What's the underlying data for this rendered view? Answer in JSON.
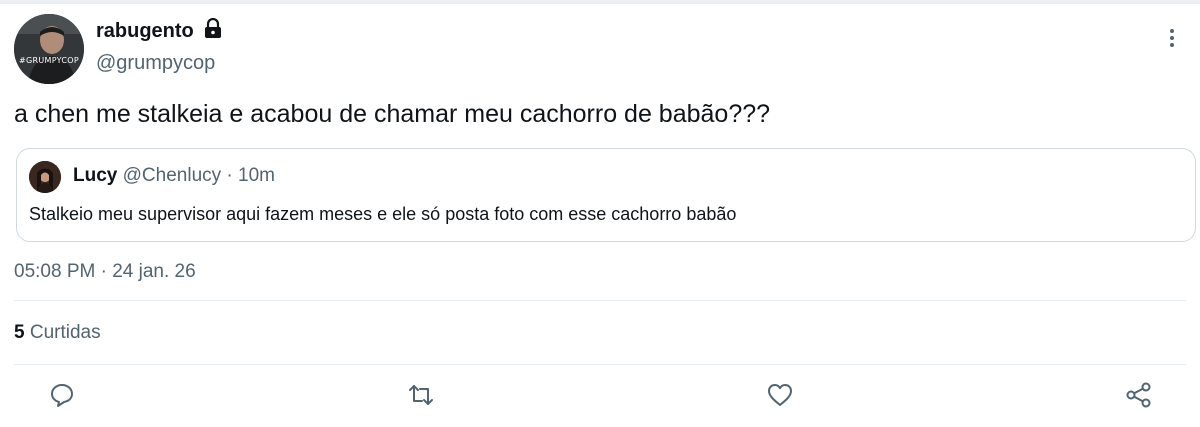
{
  "author": {
    "display_name": "rabugento",
    "handle": "@grumpycop",
    "avatar_caption": "#GRUMPYCOP"
  },
  "tweet": {
    "text": "a chen me stalkeia e acabou de chamar meu cachorro de babão???",
    "timestamp": "05:08 PM · 24 jan. 26"
  },
  "quote": {
    "name": "Lucy",
    "handle_time": "@Chenlucy · 10m",
    "text": "Stalkeio meu supervisor aqui fazem meses e ele só posta foto com esse cachorro babão"
  },
  "stats": {
    "likes_count": "5",
    "likes_label": "Curtidas"
  },
  "icons": {
    "lock": "lock-icon",
    "more": "more-vertical-icon",
    "reply": "reply-icon",
    "retweet": "retweet-icon",
    "like": "heart-icon",
    "share": "share-icon"
  },
  "colors": {
    "text": "#0f1419",
    "secondary": "#536471",
    "border": "#cfd9de"
  }
}
